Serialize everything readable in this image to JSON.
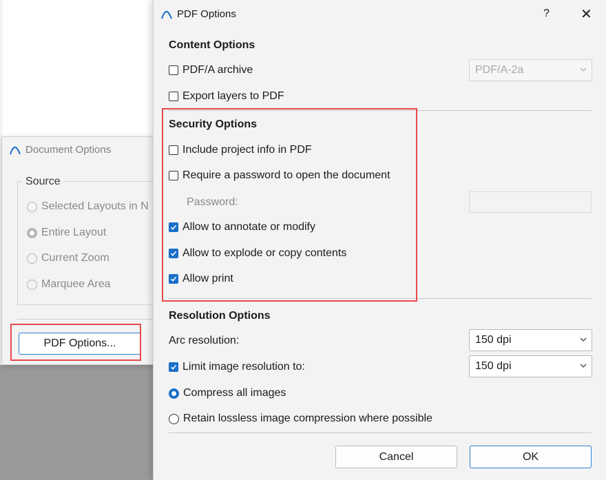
{
  "document_options": {
    "title": "Document Options",
    "source_label": "Source",
    "radios": [
      {
        "label": "Selected Layouts in N",
        "checked": false
      },
      {
        "label": "Entire Layout",
        "checked": true
      },
      {
        "label": "Current Zoom",
        "checked": false
      },
      {
        "label": "Marquee Area",
        "checked": false
      }
    ],
    "pdf_options_button": "PDF Options..."
  },
  "pdf_options": {
    "title": "PDF Options",
    "help": "?",
    "close": "✕",
    "content": {
      "heading": "Content Options",
      "pdfa_label": "PDF/A archive",
      "pdfa_checked": false,
      "pdfa_select": "PDF/A-2a",
      "export_layers_label": "Export layers to PDF",
      "export_layers_checked": false
    },
    "security": {
      "heading": "Security Options",
      "include_project_info": "Include project info in PDF",
      "require_password": "Require a password to open the document",
      "password_label": "Password:",
      "allow_annotate": "Allow to annotate or modify",
      "allow_explode": "Allow to explode or copy contents",
      "allow_print": "Allow print"
    },
    "resolution": {
      "heading": "Resolution Options",
      "arc_label": "Arc resolution:",
      "arc_value": "150 dpi",
      "limit_label": "Limit image resolution to:",
      "limit_value": "150 dpi",
      "compress_label": "Compress all images",
      "retain_label": "Retain lossless image compression where possible"
    },
    "cancel": "Cancel",
    "ok": "OK"
  },
  "colors": {
    "accent": "#1a6fc9",
    "highlight": "#e8484c"
  }
}
